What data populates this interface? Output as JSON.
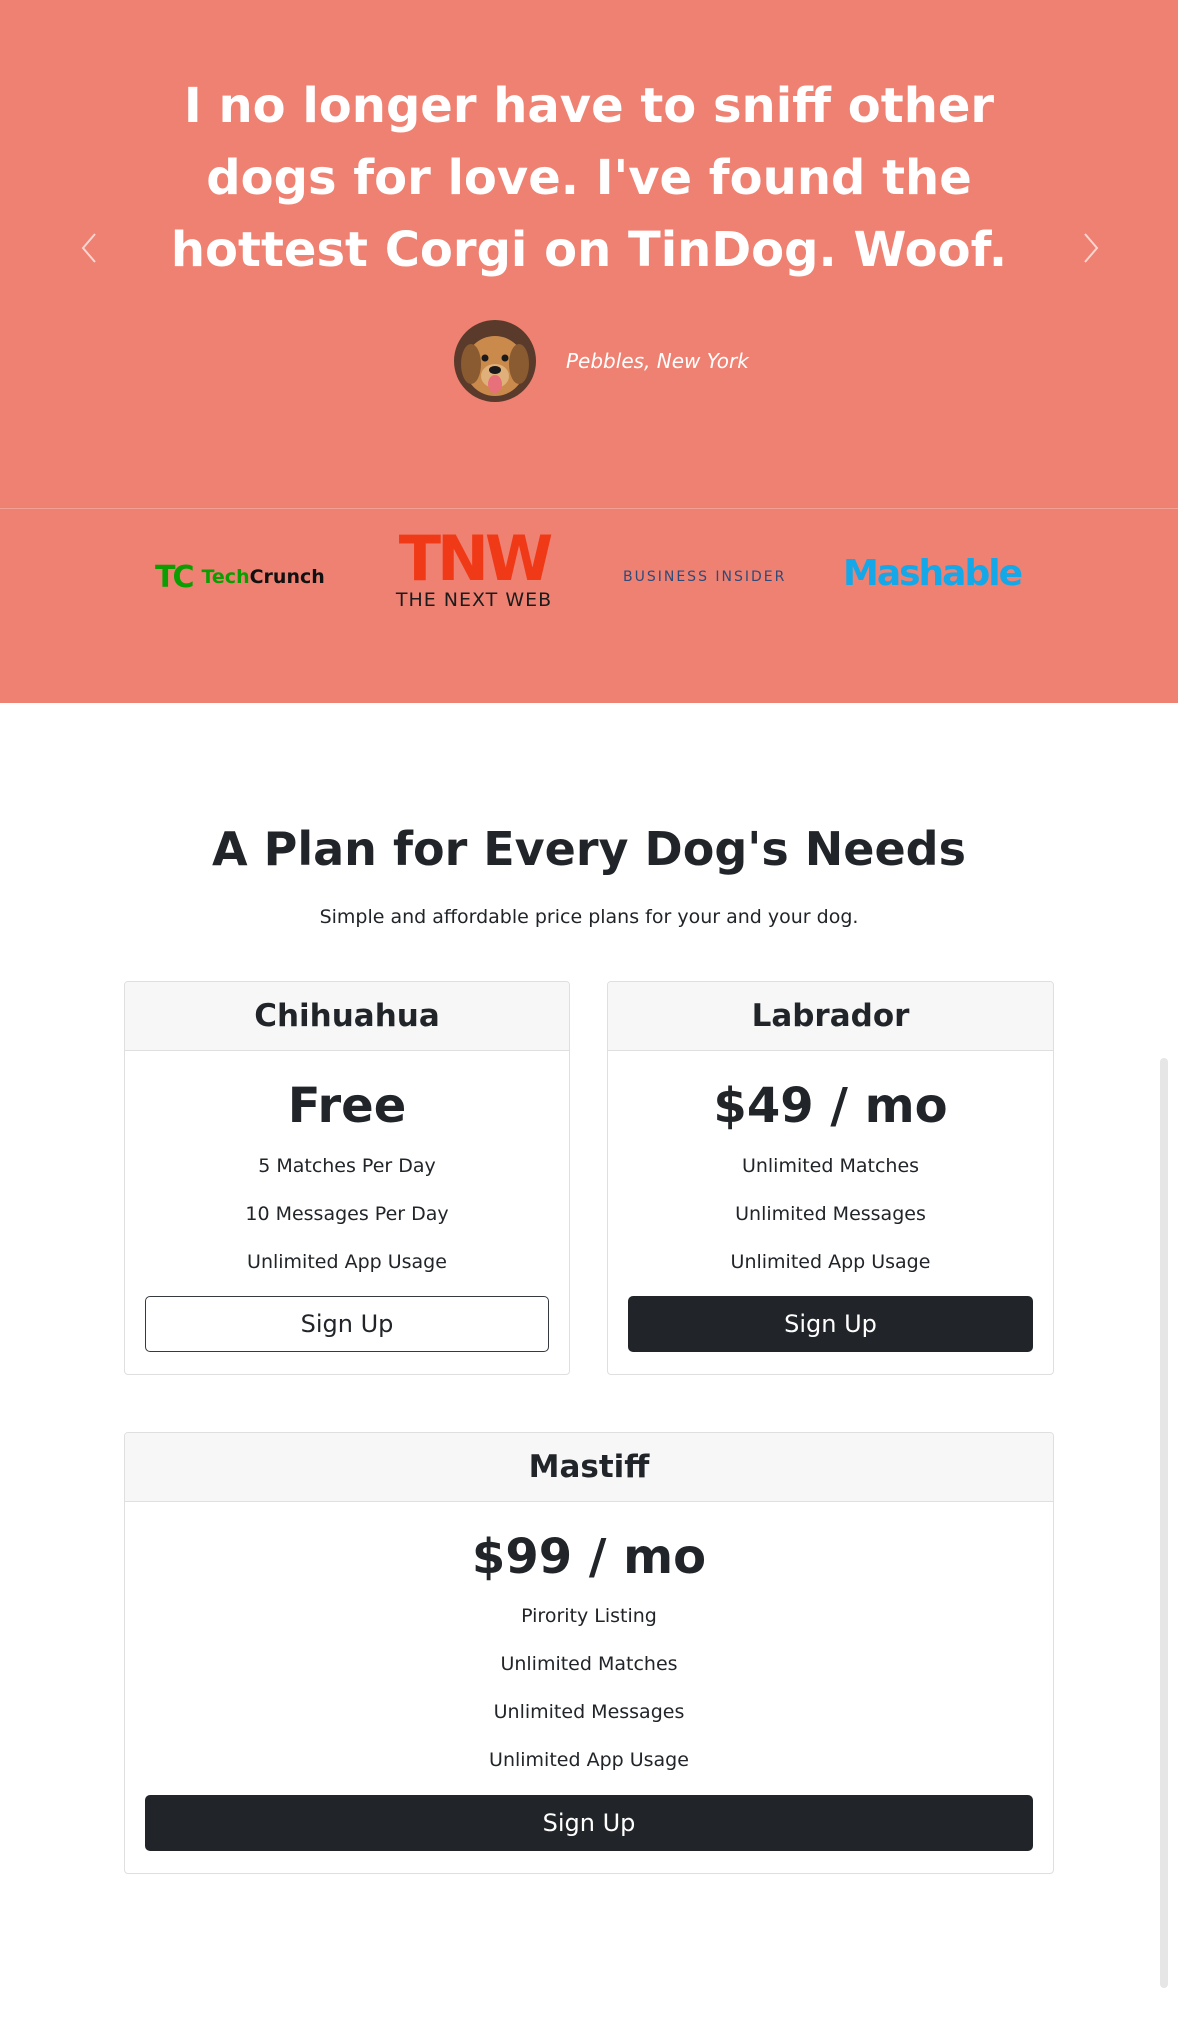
{
  "testimonial": {
    "quote": "I no longer have to sniff other dogs for love. I've found the hottest Corgi on TinDog. Woof.",
    "author": "Pebbles, New York"
  },
  "press": {
    "techcrunch_mark": "TC",
    "techcrunch_a": "Tech",
    "techcrunch_b": "Crunch",
    "tnw_letters": "TNW",
    "tnw_sub": "THE NEXT WEB",
    "business_insider": "BUSINESS INSIDER",
    "mashable": "Mashable"
  },
  "pricing": {
    "title": "A Plan for Every Dog's Needs",
    "subtitle": "Simple and affordable price plans for your and your dog.",
    "plans": [
      {
        "name": "Chihuahua",
        "price": "Free",
        "features": [
          "5 Matches Per Day",
          "10 Messages Per Day",
          "Unlimited App Usage"
        ],
        "button": "Sign Up"
      },
      {
        "name": "Labrador",
        "price": "$49 / mo",
        "features": [
          "Unlimited Matches",
          "Unlimited Messages",
          "Unlimited App Usage"
        ],
        "button": "Sign Up"
      },
      {
        "name": "Mastiff",
        "price": "$99 / mo",
        "features": [
          "Pirority Listing",
          "Unlimited Matches",
          "Unlimited Messages",
          "Unlimited App Usage"
        ],
        "button": "Sign Up"
      }
    ]
  },
  "icons": {
    "prev": "chevron-left-icon",
    "next": "chevron-right-icon"
  },
  "colors": {
    "hero_bg": "#ef8172",
    "dark": "#212529"
  }
}
